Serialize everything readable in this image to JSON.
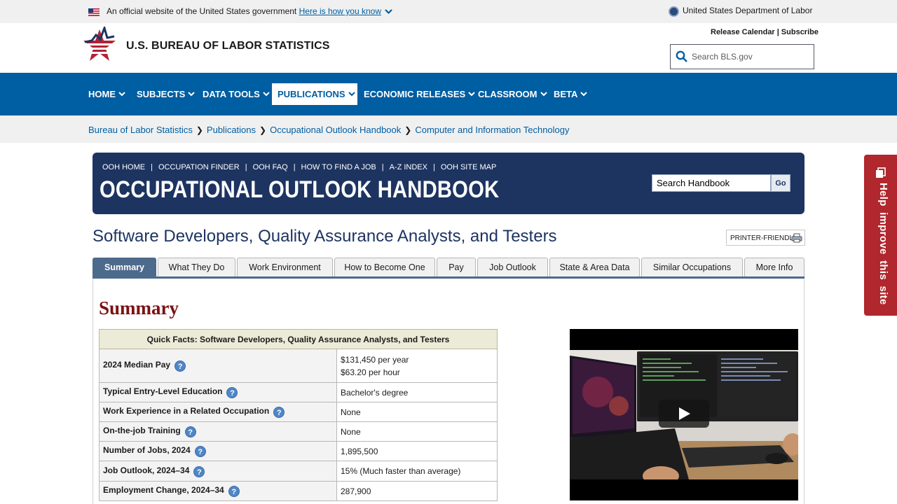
{
  "gov_banner": {
    "official_text": "An official website of the United States government",
    "how_you_know": "Here is how you know",
    "department": "United States Department of Labor"
  },
  "header": {
    "agency_name": "U.S. BUREAU OF LABOR STATISTICS",
    "release_calendar": "Release Calendar",
    "subscribe": "Subscribe",
    "search_placeholder": "Search BLS.gov"
  },
  "nav": {
    "items": [
      {
        "label": "HOME"
      },
      {
        "label": "SUBJECTS"
      },
      {
        "label": "DATA TOOLS"
      },
      {
        "label": "PUBLICATIONS"
      },
      {
        "label": "ECONOMIC RELEASES"
      },
      {
        "label": "CLASSROOM"
      },
      {
        "label": "BETA"
      }
    ],
    "active": "PUBLICATIONS"
  },
  "breadcrumb": [
    "Bureau of Labor Statistics",
    "Publications",
    "Occupational Outlook Handbook",
    "Computer and Information Technology"
  ],
  "ooh": {
    "links": [
      "OOH HOME",
      "OCCUPATION FINDER",
      "OOH FAQ",
      "HOW TO FIND A JOB",
      "A-Z INDEX",
      "OOH SITE MAP"
    ],
    "title": "OCCUPATIONAL OUTLOOK HANDBOOK",
    "search_placeholder": "Search Handbook",
    "go_label": "Go"
  },
  "page": {
    "title": "Software Developers, Quality Assurance Analysts, and Testers",
    "printer_friendly": "PRINTER-FRIENDLY"
  },
  "tabs": [
    {
      "label": "Summary"
    },
    {
      "label": "What They Do"
    },
    {
      "label": "Work Environment"
    },
    {
      "label": "How to Become One"
    },
    {
      "label": "Pay"
    },
    {
      "label": "Job Outlook"
    },
    {
      "label": "State & Area Data"
    },
    {
      "label": "Similar Occupations"
    },
    {
      "label": "More Info"
    }
  ],
  "summary": {
    "heading": "Summary",
    "quick_facts_caption": "Quick Facts: Software Developers, Quality Assurance Analysts, and Testers",
    "rows": [
      {
        "label": "2024 Median Pay",
        "value": "$131,450 per year",
        "value2": "$63.20 per hour"
      },
      {
        "label": "Typical Entry-Level Education",
        "value": "Bachelor's degree"
      },
      {
        "label": "Work Experience in a Related Occupation",
        "value": "None"
      },
      {
        "label": "On-the-job Training",
        "value": "None"
      },
      {
        "label": "Number of Jobs, 2024",
        "value": "1,895,500"
      },
      {
        "label": "Job Outlook, 2024–34",
        "value": "15% (Much faster than average)"
      },
      {
        "label": "Employment Change, 2024–34",
        "value": "287,900"
      }
    ],
    "help_glyph": "?"
  },
  "feedback": {
    "label": "Help improve this site"
  },
  "colors": {
    "nav_blue": "#005ea2",
    "ooh_navy": "#1d3461",
    "summary_red": "#7b1113",
    "feedback_red": "#b0272d",
    "tab_active": "#4c6a8c"
  }
}
